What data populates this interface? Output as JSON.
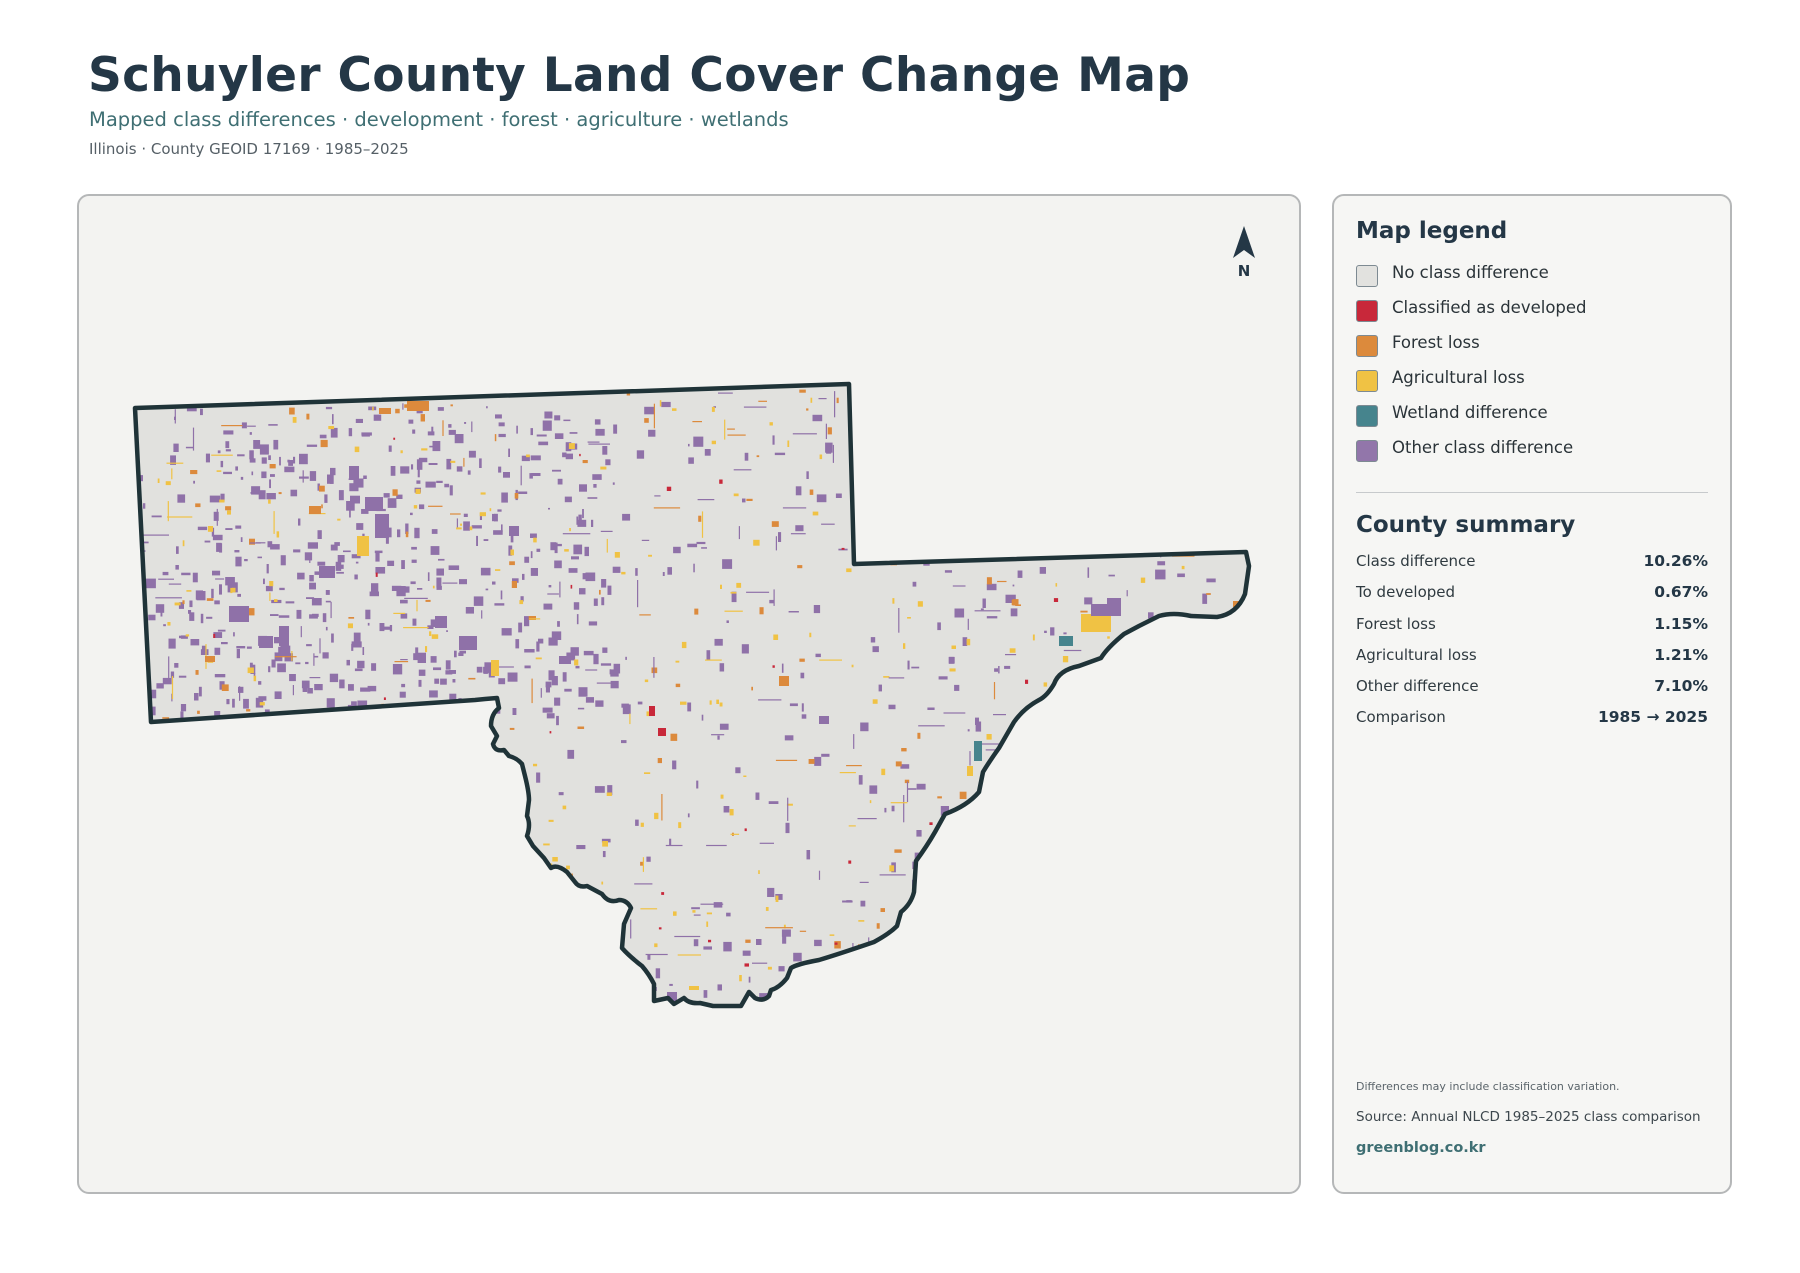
{
  "header": {
    "title": "Schuyler County Land Cover Change Map",
    "subtitle": "Mapped class differences · development · forest · agriculture · wetlands",
    "meta": "Illinois · County GEOID 17169 · 1985–2025"
  },
  "map": {
    "north_arrow_label": "N",
    "colors": {
      "no_change": "#e1e1de",
      "developed": "#c8283a",
      "forest_loss": "#dc8a3c",
      "agricultural_loss": "#f0c244",
      "wetland": "#46848d",
      "other": "#8f71a8",
      "boundary": "#1f3338"
    }
  },
  "legend": {
    "title": "Map legend",
    "items": [
      {
        "label": "No class difference",
        "color": "#e2e2df"
      },
      {
        "label": "Classified as developed",
        "color": "#c8283a"
      },
      {
        "label": "Forest loss",
        "color": "#dc8a3c"
      },
      {
        "label": "Agricultural loss",
        "color": "#f0c244"
      },
      {
        "label": "Wetland difference",
        "color": "#46848d"
      },
      {
        "label": "Other class difference",
        "color": "#9276aa"
      }
    ]
  },
  "summary": {
    "title": "County summary",
    "rows": [
      {
        "key": "Class difference",
        "value": "10.26%"
      },
      {
        "key": "To developed",
        "value": "0.67%"
      },
      {
        "key": "Forest loss",
        "value": "1.15%"
      },
      {
        "key": "Agricultural loss",
        "value": "1.21%"
      },
      {
        "key": "Other difference",
        "value": "7.10%"
      },
      {
        "key": "Comparison",
        "value": "1985 → 2025"
      }
    ]
  },
  "footer": {
    "note": "Differences may include classification variation.",
    "source": "Source: Annual NLCD 1985–2025 class comparison",
    "site": "greenblog.co.kr"
  }
}
